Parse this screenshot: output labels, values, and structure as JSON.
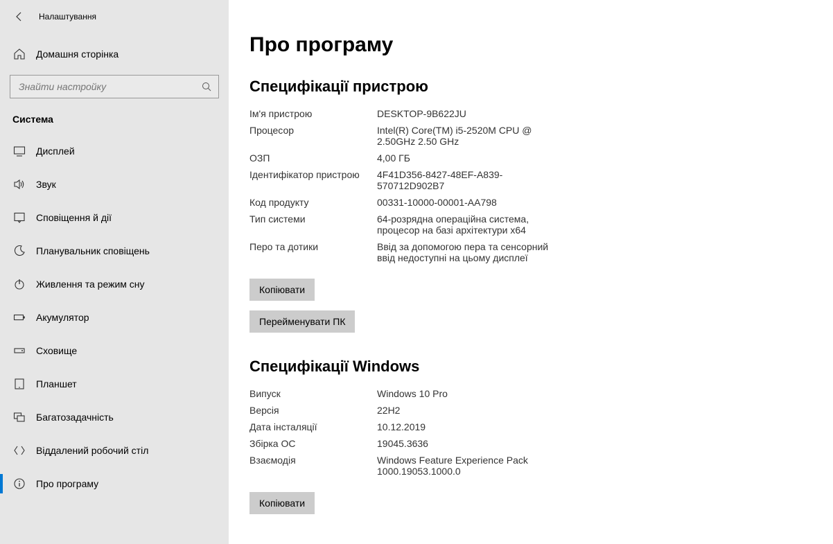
{
  "window": {
    "title": "Налаштування"
  },
  "sidebar": {
    "home": "Домашня сторінка",
    "search_placeholder": "Знайти настройку",
    "section": "Система",
    "items": [
      {
        "label": "Дисплей",
        "icon": "display"
      },
      {
        "label": "Звук",
        "icon": "sound"
      },
      {
        "label": "Сповіщення й дії",
        "icon": "notifications"
      },
      {
        "label": "Планувальник сповіщень",
        "icon": "moon"
      },
      {
        "label": "Живлення та режим сну",
        "icon": "power"
      },
      {
        "label": "Акумулятор",
        "icon": "battery"
      },
      {
        "label": "Сховище",
        "icon": "storage"
      },
      {
        "label": "Планшет",
        "icon": "tablet"
      },
      {
        "label": "Багатозадачність",
        "icon": "multitask"
      },
      {
        "label": "Віддалений робочий стіл",
        "icon": "remote"
      },
      {
        "label": "Про програму",
        "icon": "info",
        "active": true
      }
    ]
  },
  "main": {
    "title": "Про програму",
    "device_spec_title": "Специфікації пристрою",
    "device_specs": [
      {
        "label": "Ім'я пристрою",
        "value": "DESKTOP-9B622JU"
      },
      {
        "label": "Процесор",
        "value": "Intel(R) Core(TM) i5-2520M CPU @ 2.50GHz   2.50 GHz"
      },
      {
        "label": "ОЗП",
        "value": "4,00 ГБ"
      },
      {
        "label": "Ідентифікатор пристрою",
        "value": "4F41D356-8427-48EF-A839-570712D902B7"
      },
      {
        "label": "Код продукту",
        "value": "00331-10000-00001-AA798"
      },
      {
        "label": "Тип системи",
        "value": "64-розрядна операційна система, процесор на базі архітектури x64"
      },
      {
        "label": "Перо та дотики",
        "value": "Ввід за допомогою пера та сенсорний ввід недоступні на цьому дисплеї"
      }
    ],
    "copy_btn": "Копіювати",
    "rename_btn": "Перейменувати ПК",
    "windows_spec_title": "Специфікації Windows",
    "windows_specs": [
      {
        "label": "Випуск",
        "value": "Windows 10 Pro"
      },
      {
        "label": "Версія",
        "value": "22H2"
      },
      {
        "label": "Дата інсталяції",
        "value": "10.12.2019"
      },
      {
        "label": "Збірка ОС",
        "value": "19045.3636"
      },
      {
        "label": "Взаємодія",
        "value": "Windows Feature Experience Pack 1000.19053.1000.0"
      }
    ],
    "copy_btn2": "Копіювати"
  }
}
